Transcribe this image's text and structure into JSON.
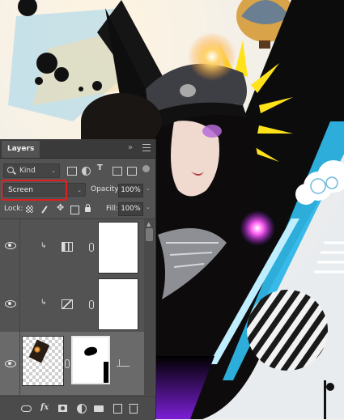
{
  "panel": {
    "tab_label": "Layers",
    "collapse_glyph": "»",
    "filter": {
      "kind_label": "Kind",
      "caret": "⌄"
    },
    "blend": {
      "mode": "Screen",
      "caret": "⌄"
    },
    "opacity": {
      "label": "Opacity:",
      "value": "100%",
      "caret": "⌄"
    },
    "lock": {
      "label": "Lock:"
    },
    "fill": {
      "label": "Fill:",
      "value": "100%",
      "caret": "⌄"
    },
    "layers": [
      {
        "type": "adjustment",
        "icon": "levels-icon",
        "clip_glyph": "↳",
        "visible": true
      },
      {
        "type": "adjustment",
        "icon": "curves-icon",
        "clip_glyph": "↳",
        "visible": true
      },
      {
        "type": "image-with-mask",
        "visible": true,
        "selected": true
      }
    ],
    "footer_fx": "fx"
  },
  "colors": {
    "panel_bg": "#535353",
    "header_bg": "#3a3a3a",
    "highlight": "#e02020",
    "accent_cyan": "#2fb6e6",
    "accent_yellow": "#ffe21a",
    "accent_magenta": "#d33cff"
  }
}
